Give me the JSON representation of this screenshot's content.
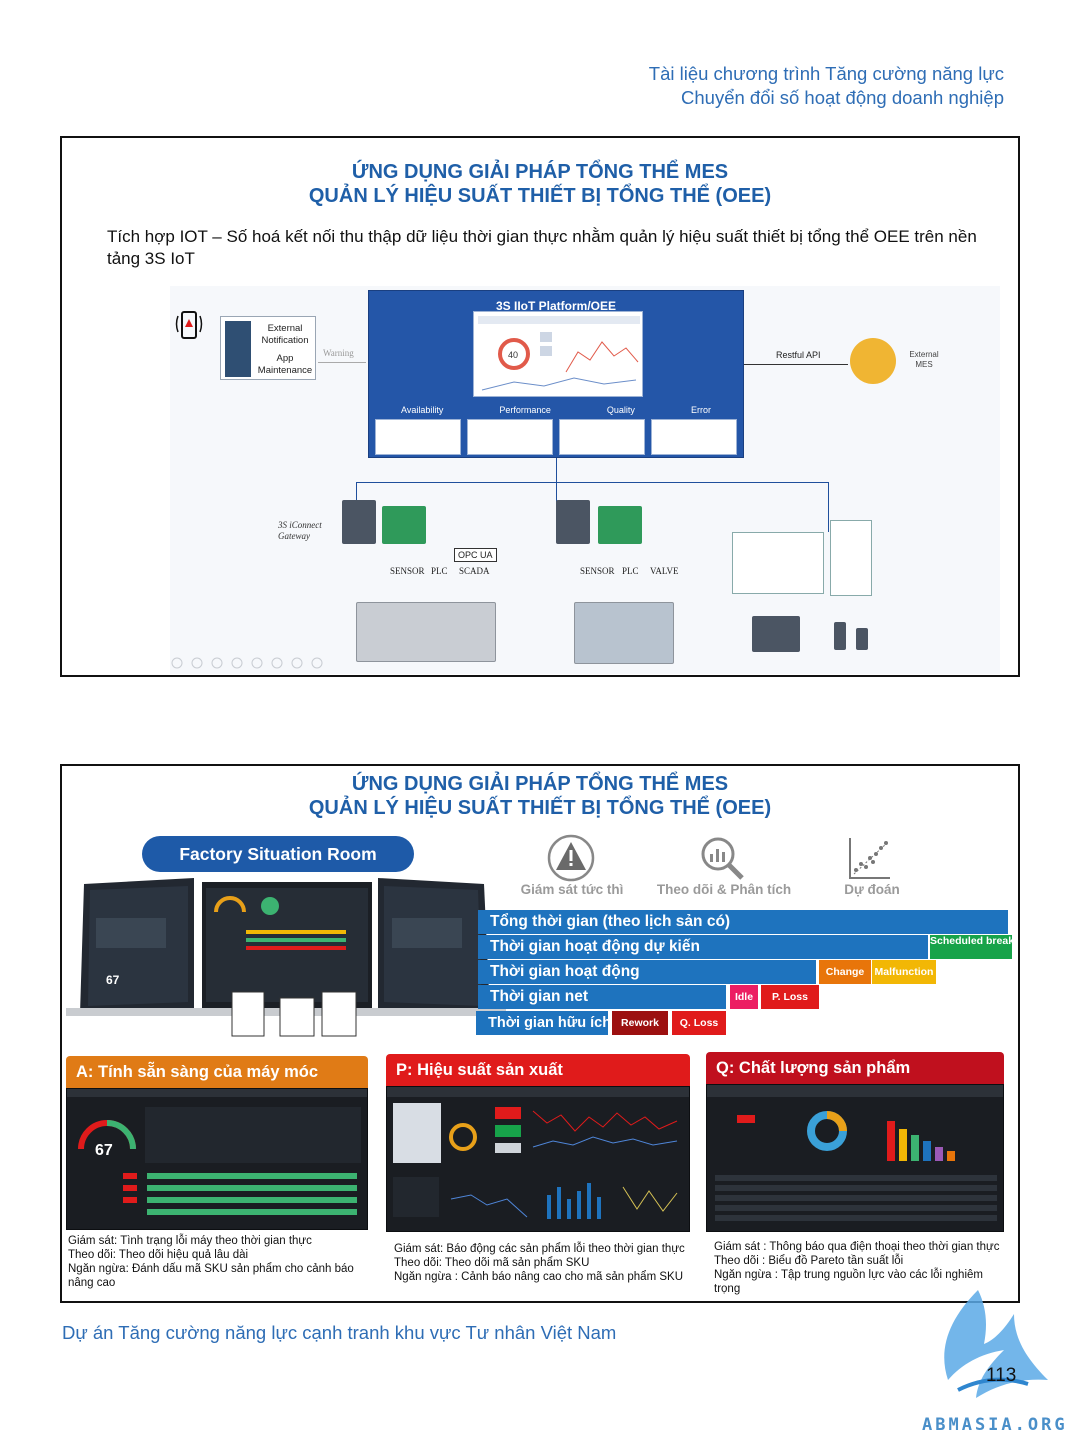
{
  "header": {
    "line1": "Tài liệu chương trình Tăng cường năng lực",
    "line2": "Chuyển đổi số hoạt động doanh nghiệp"
  },
  "panel1": {
    "title_line1": "ỨNG DỤNG GIẢI PHÁP TỔNG THỂ MES",
    "title_line2": "QUẢN LÝ HIỆU SUẤT THIẾT BỊ TỔNG THỂ (OEE)",
    "intro": "Tích hợp IOT – Số hoá kết nối thu thập dữ liệu thời gian thực nhằm quản lý hiệu suất thiết bị tổng thể OEE trên nền tảng 3S IoT",
    "diagram": {
      "platform_title": "3S IIoT Platform/OEE",
      "notif_label1": "External Notification",
      "notif_label2": "App Maintenance",
      "warning_label": "Warning",
      "restful_label": "Restful API",
      "external_mes_label": "External MES",
      "module_labels": [
        "Availability",
        "Performance",
        "Quality",
        "Error"
      ],
      "gauge_value": "40",
      "gateway_label": "3S iConnect Gateway",
      "group1_labels": [
        "SENSOR",
        "PLC",
        "SCADA"
      ],
      "group2_labels": [
        "SENSOR",
        "PLC",
        "VALVE"
      ],
      "opc_label": "OPC UA"
    }
  },
  "panel2": {
    "title_line1": "ỨNG DỤNG GIẢI PHÁP TỔNG THỂ MES",
    "title_line2": "QUẢN LÝ HIỆU SUẤT THIẾT BỊ TỔNG THỂ (OEE)",
    "fsr_label": "Factory Situation Room",
    "room_gauge_value": "67",
    "icons": [
      {
        "label": "Giám sát tức thì",
        "icon": "warning-icon"
      },
      {
        "label": "Theo dõi & Phân tích",
        "icon": "magnifier-chart-icon"
      },
      {
        "label": "Dự đoán",
        "icon": "scatter-plot-icon"
      }
    ],
    "oee_bars": {
      "total_time": "Tổng thời gian  (theo lịch sản có)",
      "planned_time": "Thời gian hoạt động dự kiến",
      "scheduled_break": "Scheduled break",
      "operating_time": "Thời gian hoạt động",
      "change": "Change",
      "malfunction": "Malfunction",
      "net_time": "Thời gian net",
      "idle": "Idle",
      "p_loss": "P. Loss",
      "useful_time": "Thời gian hữu ích",
      "rework": "Rework",
      "q_loss": "Q. Loss"
    },
    "colors": {
      "blue": "#1e73be",
      "green": "#17a34a",
      "orange": "#e8750a",
      "yellow": "#f2b705",
      "pink": "#ec1e63",
      "red": "#e01b1b",
      "darkred": "#9c1010"
    },
    "cards": [
      {
        "title": "A:  Tính sẵn sàng của máy móc",
        "color": "#e07b16",
        "gauge_value": "67",
        "text": [
          "Giám sát: Tình trạng lỗi máy theo thời gian thực",
          "Theo dõi:  Theo dõi hiệu quả lâu dài",
          "Ngăn ngừa:  Đánh dấu mã SKU sản phẩm cho cảnh báo nâng cao"
        ]
      },
      {
        "title": "P: Hiệu suất sản xuất",
        "color": "#e01b1b",
        "text": [
          "Giám sát: Báo động các sản phẩm lỗi theo thời gian thực",
          "Theo dõi:  Theo dõi mã sản phẩm SKU",
          "Ngăn ngừa : Cảnh báo nâng cao cho mã sản phẩm SKU"
        ]
      },
      {
        "title": "Q: Chất lượng sản phẩm",
        "color": "#c0101e",
        "text": [
          "Giám sát : Thông báo qua điện thoại theo thời gian thực",
          "Theo dõi :  Biểu đồ Pareto tần suất lỗi",
          "Ngăn ngừa : Tập trung nguồn lực vào các lỗi nghiêm trọng"
        ]
      }
    ]
  },
  "footer": "Dự án Tăng cường năng lực cạnh tranh khu vực Tư nhân Việt Nam",
  "page_number": "113",
  "logo_text": "ABMASIA.ORG"
}
